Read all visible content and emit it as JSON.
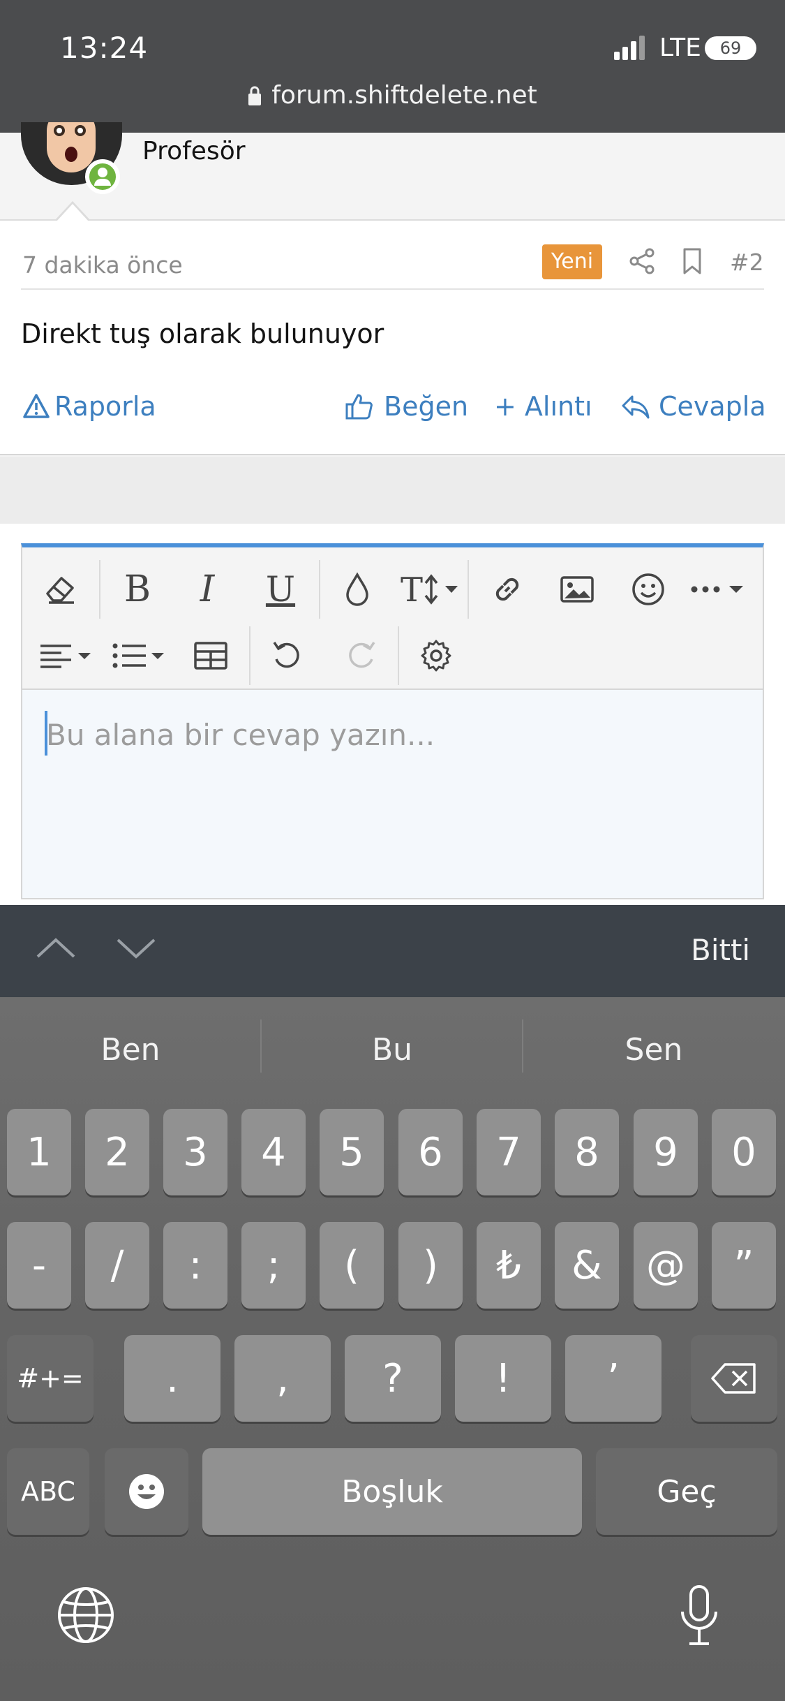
{
  "status": {
    "time": "13:24",
    "network": "LTE",
    "battery": "69"
  },
  "browser": {
    "url": "forum.shiftdelete.net"
  },
  "post": {
    "author_rank": "Profesör",
    "time_ago": "7 dakika önce",
    "badge": "Yeni",
    "number": "#2",
    "text": "Direkt tuş olarak bulunuyor",
    "actions": {
      "report": "Raporla",
      "like": "Beğen",
      "quote": "+ Alıntı",
      "reply": "Cevapla"
    }
  },
  "editor": {
    "placeholder": "Bu alana bir cevap yazın..."
  },
  "accessory": {
    "done": "Bitti"
  },
  "keyboard": {
    "suggestions": [
      "Ben",
      "Bu",
      "Sen"
    ],
    "row1": [
      "1",
      "2",
      "3",
      "4",
      "5",
      "6",
      "7",
      "8",
      "9",
      "0"
    ],
    "row2": [
      "-",
      "/",
      ":",
      ";",
      "(",
      ")",
      "₺",
      "&",
      "@",
      "”"
    ],
    "row3_left": "#+=",
    "row3": [
      ".",
      ",",
      "?",
      "!",
      "’"
    ],
    "abc": "ABC",
    "space": "Boşluk",
    "go": "Geç"
  },
  "colors": {
    "accent": "#3d7fbf",
    "badge": "#e8953a",
    "editor_border": "#4a90d9",
    "online": "#6fb43f"
  }
}
